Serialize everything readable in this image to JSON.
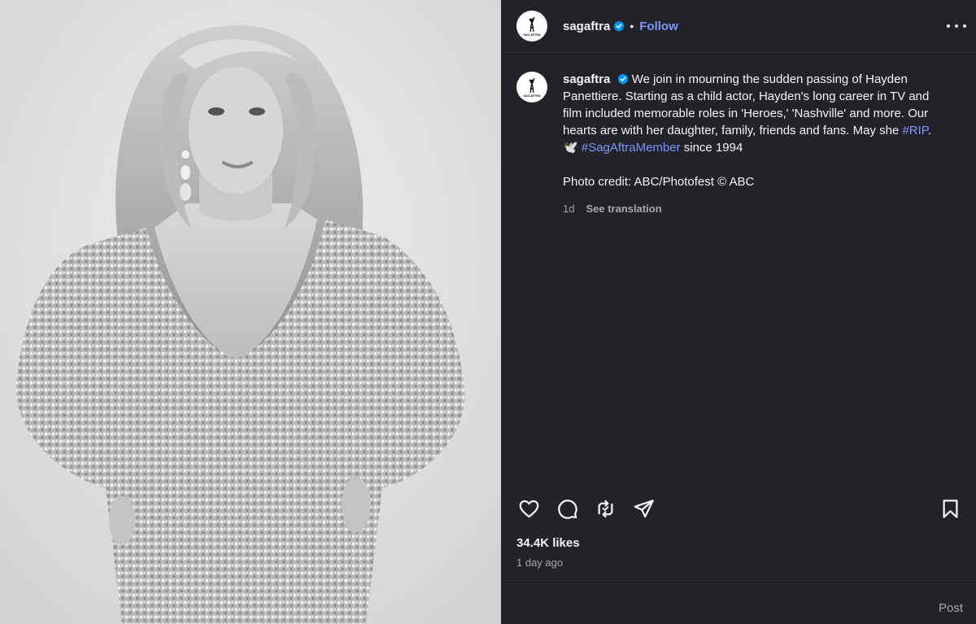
{
  "account": {
    "username": "sagaftra",
    "separator": "•",
    "follow_label": "Follow",
    "avatar_text": "SAG-AFTRA"
  },
  "caption": {
    "username": "sagaftra",
    "text_1": "We join in mourning the sudden passing of Hayden Panettiere. Starting as a child actor, Hayden's long career in TV and film included memorable roles in 'Heroes,' 'Nashville' and more. Our hearts are with her daughter, family, friends and fans. May she ",
    "hashtag_1": "#RIP",
    "text_2": ". 🕊️ ",
    "hashtag_2": "#SagAftraMember",
    "text_3": " since 1994",
    "credit": "Photo credit: ABC/Photofest © ABC",
    "age": "1d",
    "see_translation": "See translation"
  },
  "engagement": {
    "likes": "34.4K likes",
    "timestamp": "1 day ago"
  },
  "comment": {
    "post_label": "Post"
  },
  "icons": {
    "like": "heart-icon",
    "comment": "comment-icon",
    "repost": "repost-icon",
    "share": "share-icon",
    "save": "bookmark-icon",
    "more": "more-options-icon",
    "verified": "verified-badge-icon"
  },
  "colors": {
    "panel_bg": "#212328",
    "link": "#7d95ff",
    "muted": "#a8a8a8",
    "verified": "#0095f6"
  }
}
